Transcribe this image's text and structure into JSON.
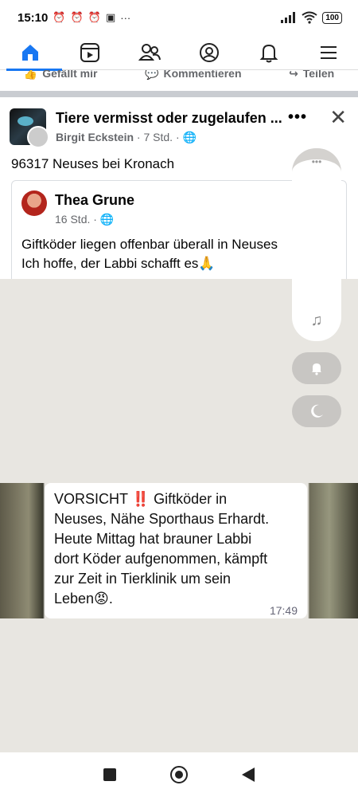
{
  "status_bar": {
    "time": "15:10",
    "more": "···",
    "battery": "100"
  },
  "nav": {
    "items": [
      "home",
      "reels",
      "friends",
      "profile",
      "notifications",
      "menu"
    ]
  },
  "action_bar": {
    "like": "Gefällt mir",
    "comment": "Kommentieren",
    "share": "Teilen"
  },
  "post": {
    "group_title": "Tiere vermisst oder zugelaufen ...",
    "author": "Birgit Eckstein",
    "time": "7 Std.",
    "text": "96317 Neuses bei Kronach",
    "more": "•••",
    "close": "✕"
  },
  "shared": {
    "name": "Thea Grune",
    "time": "16 Std.",
    "line1": "Giftköder liegen offenbar überall in Neuses",
    "line2": "Ich hoffe, der Labbi schafft es🙏"
  },
  "message": {
    "text": "VORSICHT ‼️ Giftköder in\nNeuses, Nähe Sporthaus Erhardt.\nHeute Mittag hat brauner Labbi\ndort Köder aufgenommen, kämpft\nzur Zeit in Tierklinik um sein\nLeben😡.",
    "time": "17:49"
  },
  "floating": {
    "dots": "•••",
    "music": "♫"
  },
  "colors": {
    "accent": "#1877f2",
    "background_image": "#e8e6e1"
  }
}
